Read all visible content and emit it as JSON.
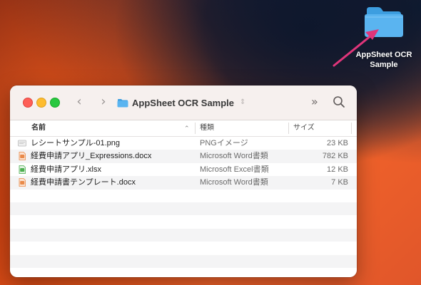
{
  "desktop": {
    "folder_label": "AppSheet OCR\nSample",
    "folder_icon": "folder-icon"
  },
  "window": {
    "title": "AppSheet OCR Sample",
    "back_icon": "chevron-left-icon",
    "forward_icon": "chevron-right-icon",
    "more_icon": "double-chevron-right-icon",
    "search_icon": "search-icon",
    "columns": {
      "name": "名前",
      "kind": "種類",
      "size": "サイズ"
    },
    "files": [
      {
        "name": "レシートサンプル-01.png",
        "kind": "PNGイメージ",
        "size": "23 KB",
        "icon": "png-file-icon",
        "icon_color": "#c9c9c9"
      },
      {
        "name": "経費申請アプリ_Expressions.docx",
        "kind": "Microsoft Word書類",
        "size": "782 KB",
        "icon": "docx-file-icon",
        "icon_color": "#e98a4a"
      },
      {
        "name": "経費申請アプリ.xlsx",
        "kind": "Microsoft Excel書類",
        "size": "12 KB",
        "icon": "xlsx-file-icon",
        "icon_color": "#4caf50"
      },
      {
        "name": "経費申請書テンプレート.docx",
        "kind": "Microsoft Word書類",
        "size": "7 KB",
        "icon": "docx-file-icon",
        "icon_color": "#e98a4a"
      }
    ]
  },
  "colors": {
    "arrow": "#e0357a",
    "folder": "#5ab4f0",
    "close": "#fe5f57",
    "minimize": "#febc2e",
    "maximize": "#28c840"
  }
}
